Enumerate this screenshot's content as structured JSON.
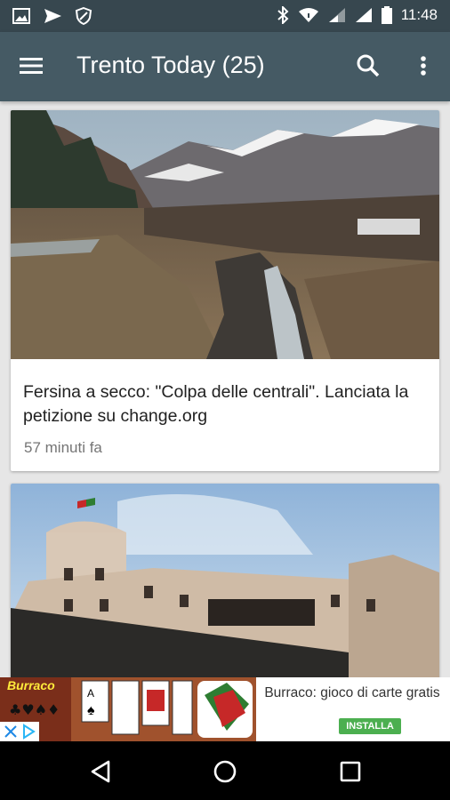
{
  "status_bar": {
    "time": "11:48",
    "left_icons": [
      "image-icon",
      "send-icon",
      "vpn-shield-icon"
    ],
    "right_icons": [
      "bluetooth-icon",
      "wifi-icon",
      "cell-signal-icon",
      "cell-signal-icon",
      "battery-icon"
    ]
  },
  "app_bar": {
    "title": "Trento Today (25)",
    "menu_icon": "hamburger-menu-icon",
    "search_icon": "search-icon",
    "more_icon": "more-vert-icon"
  },
  "feed": {
    "articles": [
      {
        "headline": "Fersina a secco: \"Colpa delle centrali\". Lanciata la petizione su change.org",
        "time": "57 minuti fa"
      },
      {
        "headline": "",
        "time": ""
      }
    ]
  },
  "ad": {
    "title": "Burraco: gioco di carte gratis",
    "button": "INSTALLA",
    "brand": "Burraco"
  },
  "nav_bar": {
    "icons": [
      "back-icon",
      "home-icon",
      "recents-icon"
    ]
  },
  "colors": {
    "status_bar": "#37474f",
    "app_bar": "#455a64",
    "background": "#e6e6e6",
    "install_button": "#4caf50"
  }
}
